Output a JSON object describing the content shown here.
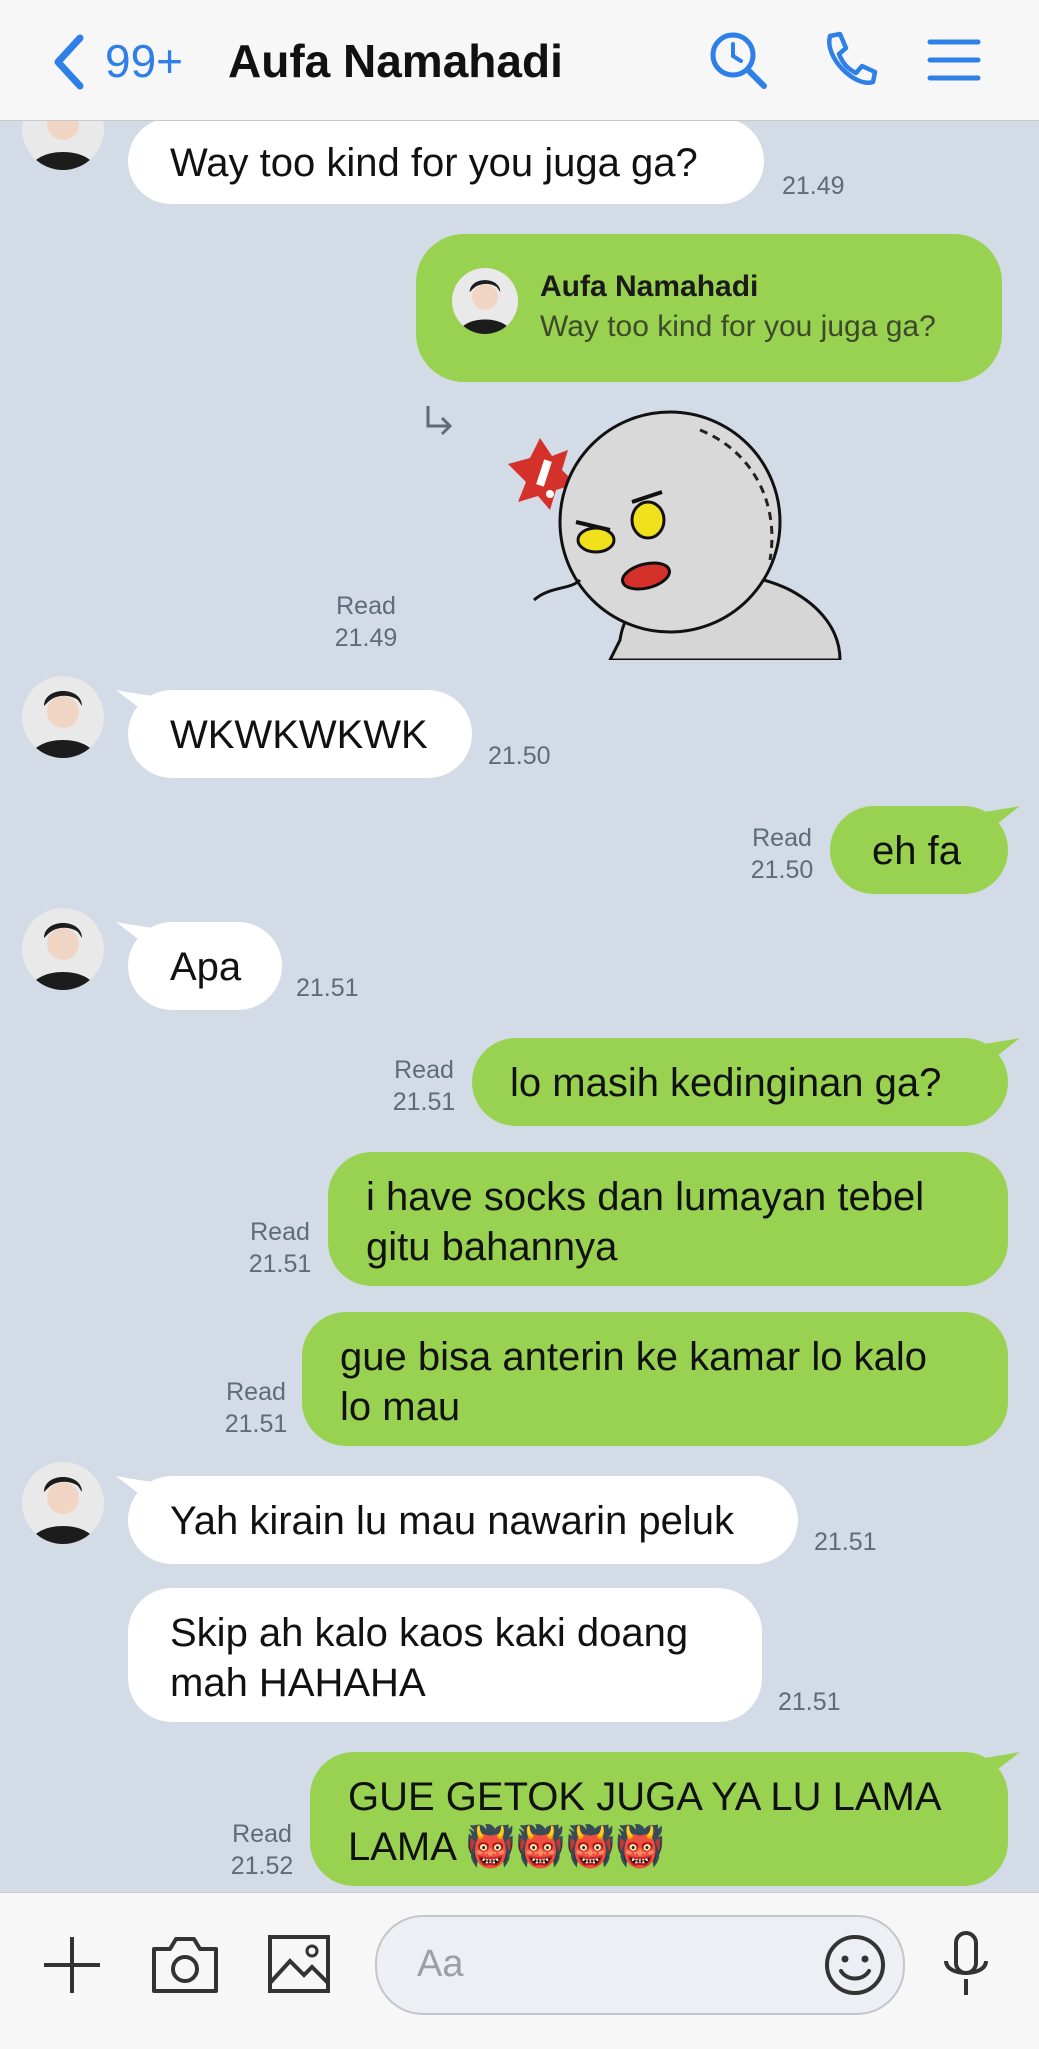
{
  "header": {
    "back_count": "99+",
    "contact_name": "Aufa Namahadi",
    "icons": [
      "back-chevron-icon",
      "search-icon",
      "phone-icon",
      "menu-icon"
    ]
  },
  "messages": [
    {
      "id": "m1",
      "side": "in",
      "text": "Way too kind for you juga ga?",
      "time": "21.49"
    },
    {
      "id": "m2",
      "side": "out",
      "reply_name": "Aufa Namahadi",
      "reply_text": "Way too kind for you juga ga?"
    },
    {
      "id": "m3",
      "side": "out",
      "type": "sticker",
      "sticker": "angry-moon-sticker",
      "read": "Read",
      "time": "21.49"
    },
    {
      "id": "m4",
      "side": "in",
      "text": "WKWKWKWK",
      "time": "21.50"
    },
    {
      "id": "m5",
      "side": "out",
      "text": "eh fa",
      "read": "Read",
      "time": "21.50"
    },
    {
      "id": "m6",
      "side": "in",
      "text": "Apa",
      "time": "21.51"
    },
    {
      "id": "m7",
      "side": "out",
      "text": "lo masih kedinginan ga?",
      "read": "Read",
      "time": "21.51"
    },
    {
      "id": "m8",
      "side": "out",
      "text": "i have socks dan lumayan tebel\ngitu bahannya",
      "read": "Read",
      "time": "21.51"
    },
    {
      "id": "m9",
      "side": "out",
      "text": "gue bisa anterin ke kamar lo kalo\nlo mau",
      "read": "Read",
      "time": "21.51"
    },
    {
      "id": "m10",
      "side": "in",
      "text": "Yah kirain lu mau nawarin peluk",
      "time": "21.51"
    },
    {
      "id": "m11",
      "side": "in",
      "text": "Skip ah kalo kaos kaki doang\nmah HAHAHA",
      "time": "21.51"
    },
    {
      "id": "m12",
      "side": "out",
      "text": "GUE GETOK JUGA YA LU LAMA\nLAMA 👹👹👹👹",
      "read": "Read",
      "time": "21.52"
    }
  ],
  "input": {
    "placeholder": "Aa"
  },
  "toolbar_icons": [
    "plus-icon",
    "camera-icon",
    "image-icon",
    "emoji-icon",
    "microphone-icon"
  ],
  "colors": {
    "background": "#d2dbe6",
    "outgoing": "#98d250",
    "incoming": "#ffffff",
    "accent": "#2f7fe8"
  }
}
